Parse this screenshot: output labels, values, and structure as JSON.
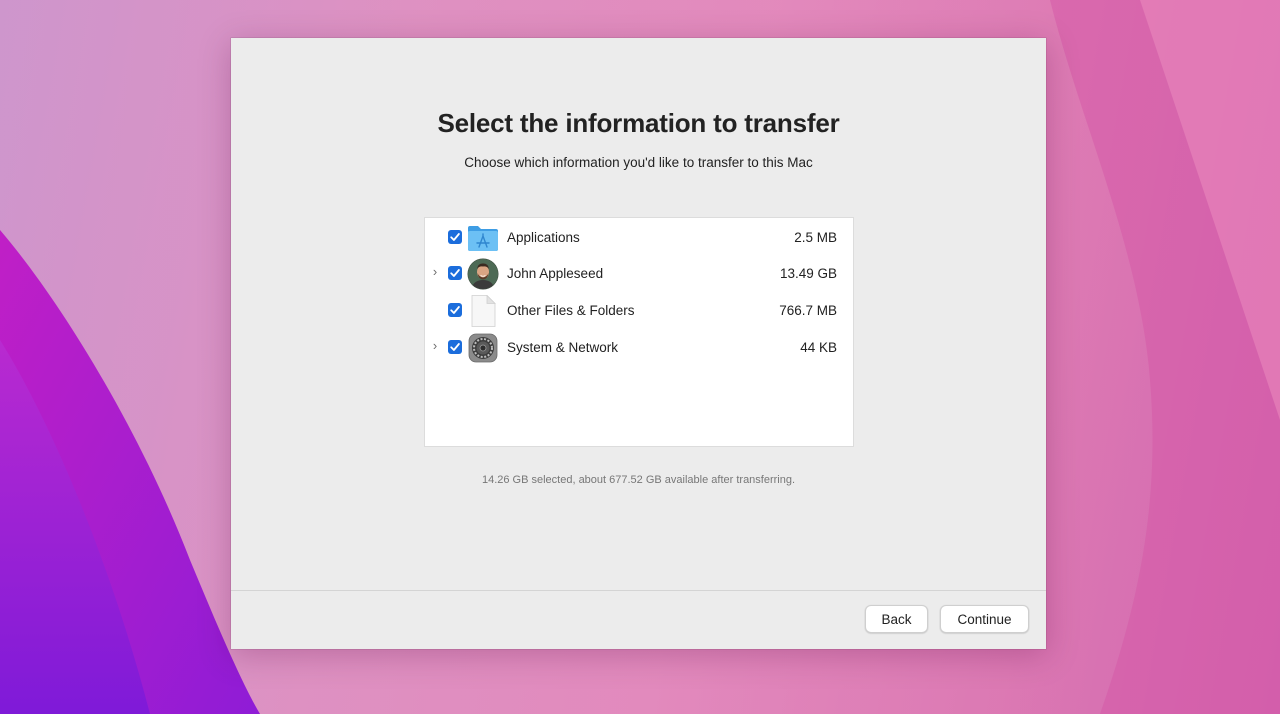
{
  "dialog": {
    "title": "Select the information to transfer",
    "subtitle": "Choose which information you'd like to transfer to this Mac",
    "summary": "14.26 GB selected, about 677.52 GB available after transferring."
  },
  "items": [
    {
      "name": "Applications",
      "size": "2.5 MB",
      "checked": true,
      "expandable": false,
      "icon": "applications-folder-icon"
    },
    {
      "name": "John Appleseed",
      "size": "13.49 GB",
      "checked": true,
      "expandable": true,
      "icon": "user-avatar-icon"
    },
    {
      "name": "Other Files & Folders",
      "size": "766.7 MB",
      "checked": true,
      "expandable": false,
      "icon": "document-icon"
    },
    {
      "name": "System & Network",
      "size": "44 KB",
      "checked": true,
      "expandable": true,
      "icon": "system-preferences-gear-icon"
    }
  ],
  "buttons": {
    "back": "Back",
    "continue": "Continue"
  },
  "colors": {
    "checkbox": "#1b6ddc",
    "window": "#ececec",
    "folder": "#5fb3ee"
  }
}
